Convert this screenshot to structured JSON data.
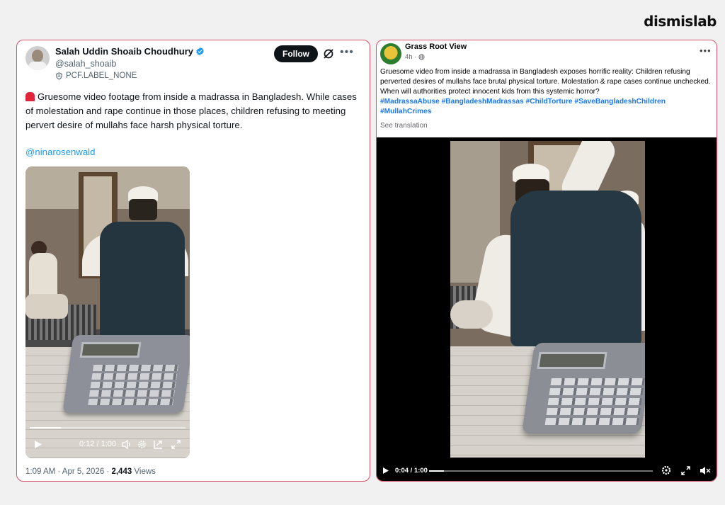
{
  "brand": "dismislab",
  "twitter_post": {
    "author_name": "Salah Uddin Shoaib Choudhury",
    "handle": "@salah_shoaib",
    "label": "PCF.LABEL_NONE",
    "follow_label": "Follow",
    "text": "Gruesome video footage from inside a madrassa in Bangladesh. While cases of molestation and rape continue in those places, children refusing to meeting pervert desire of mullahs face harsh physical torture.",
    "mention": "@ninarosenwald",
    "video": {
      "time": "0:12 / 1:00",
      "progress": 0.2
    },
    "timestamp": "1:09 AM · Apr 5, 2026 ·",
    "views_count": "2,443",
    "views_label": "Views",
    "colors": {
      "verified": "#1d9bf0",
      "link": "#1d9bf0",
      "card_border": "#d9546a"
    }
  },
  "facebook_post": {
    "page_name": "Grass Root View",
    "time": "4h ·",
    "text": "Gruesome video from inside a madrassa in Bangladesh exposes horrific reality: Children refusing perverted desires of mullahs face brutal physical torture. Molestation & rape cases continue unchecked. When will authorities protect innocent kids from this systemic horror?",
    "hashtags": "#MadrassaAbuse #BangladeshMadrassas #ChildTorture #SaveBangladeshChildren #MullahCrimes",
    "see_translation": "See translation",
    "video": {
      "time": "0:04 / 1:00",
      "progress": 0.067
    },
    "colors": {
      "hashtag": "#1877f2"
    }
  }
}
